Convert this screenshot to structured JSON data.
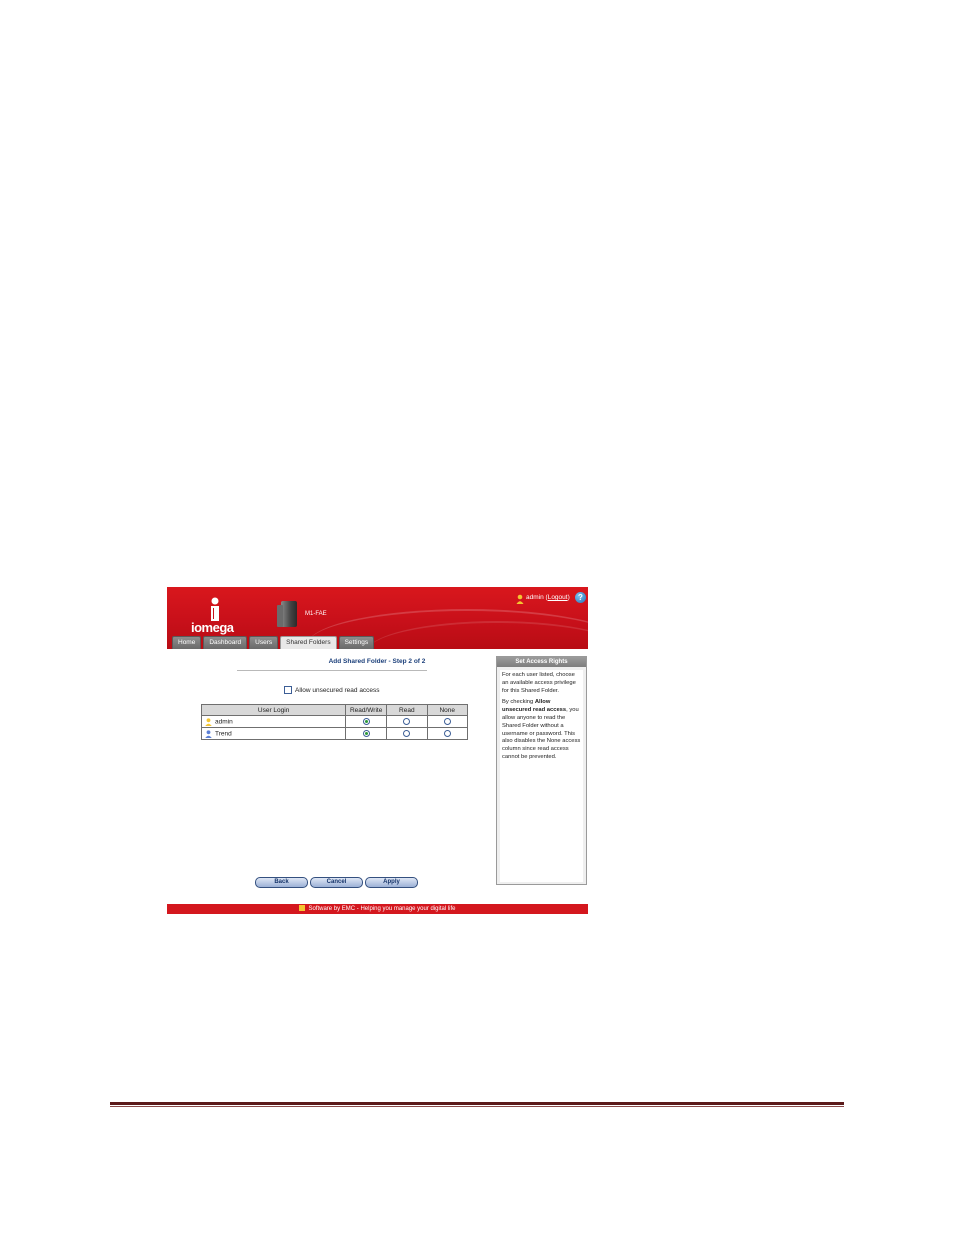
{
  "header": {
    "brand": "iomega",
    "device_name": "M1-FAE",
    "user": "admin",
    "logout_label": "Logout",
    "help_icon": "help-icon"
  },
  "tabs": [
    {
      "label": "Home",
      "active": false
    },
    {
      "label": "Dashboard",
      "active": false
    },
    {
      "label": "Users",
      "active": false
    },
    {
      "label": "Shared Folders",
      "active": true
    },
    {
      "label": "Settings",
      "active": false
    }
  ],
  "main": {
    "title": "Add Shared Folder - Step 2 of 2",
    "allow_unsecured_label": "Allow unsecured read access",
    "allow_unsecured_checked": false,
    "columns": [
      "User Login",
      "Read/Write",
      "Read",
      "None"
    ],
    "rows": [
      {
        "user": "admin",
        "icon": "admin-user-icon",
        "access": "Read/Write"
      },
      {
        "user": "Trend",
        "icon": "user-icon",
        "access": "Read/Write"
      }
    ],
    "buttons": {
      "back": "Back",
      "cancel": "Cancel",
      "apply": "Apply"
    }
  },
  "side_panel": {
    "title": "Set Access Rights",
    "para1": "For each user listed, choose an available access privilege for this Shared Folder.",
    "para2_prefix": "By checking ",
    "para2_bold": "Allow unsecured read access",
    "para2_suffix": ", you allow anyone to read the Shared Folder without a username or password. This also disables the None access column since read access cannot be prevented."
  },
  "footer": {
    "text": "Software by EMC - Helping you manage your digital life"
  },
  "colors": {
    "brand_red": "#c8101a",
    "title_blue": "#1b3f7a",
    "selected_radio": "#2e9a3a"
  }
}
